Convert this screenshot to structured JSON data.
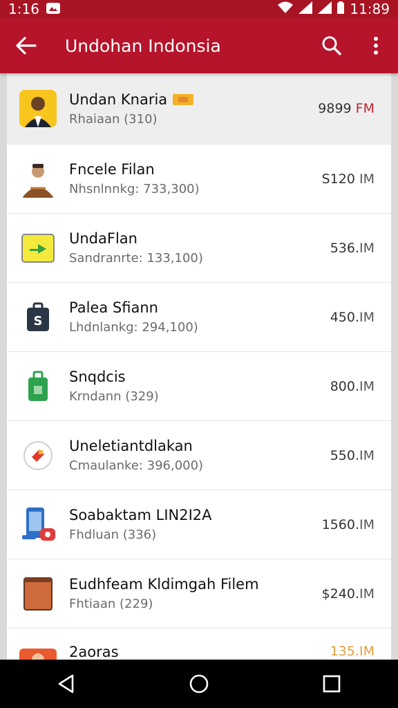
{
  "status_bar": {
    "time_left": "1:16",
    "time_right": "11:89"
  },
  "app_bar": {
    "title": "Undohan Indonsia"
  },
  "list": [
    {
      "name": "Undan Knaria",
      "sub": "Rhaiaan (310)",
      "value": "9899",
      "unit": "FM",
      "icon": "person-portrait-icon",
      "has_badge": true
    },
    {
      "name": "Fncele Filan",
      "sub": "Nhsnlnnkg: 733,300)",
      "value": "S120",
      "unit": "IM",
      "icon": "person-batik-icon"
    },
    {
      "name": "UndaFlan",
      "sub": "Sandranrte: 133,100)",
      "value": "536.",
      "unit": "IM",
      "icon": "green-arrow-icon"
    },
    {
      "name": "Palea Sfiann",
      "sub": "Lhdnlankg: 294,100)",
      "value": "450.",
      "unit": "IM",
      "icon": "shopping-bag-icon"
    },
    {
      "name": "Snqdcis",
      "sub": "Krndann (329)",
      "value": "800.",
      "unit": "IM",
      "icon": "green-bag-icon"
    },
    {
      "name": "Uneletiantdlakan",
      "sub": "Cmaulanke: 396,000)",
      "value": "550.",
      "unit": "IM",
      "icon": "tag-circle-icon"
    },
    {
      "name": "Soabaktam LIN2I2A",
      "sub": "Fhdluan (336)",
      "value": "1560.",
      "unit": "IM",
      "icon": "phone-app-icon"
    },
    {
      "name": "Eudhfeam Kldimgah Filem",
      "sub": "Fhtiaan (229)",
      "value": "$240.",
      "unit": "IM",
      "icon": "orange-box-icon"
    },
    {
      "name": "2aoras",
      "sub": "",
      "value": "135.",
      "unit": "IM",
      "icon": "person-orange-icon"
    }
  ]
}
